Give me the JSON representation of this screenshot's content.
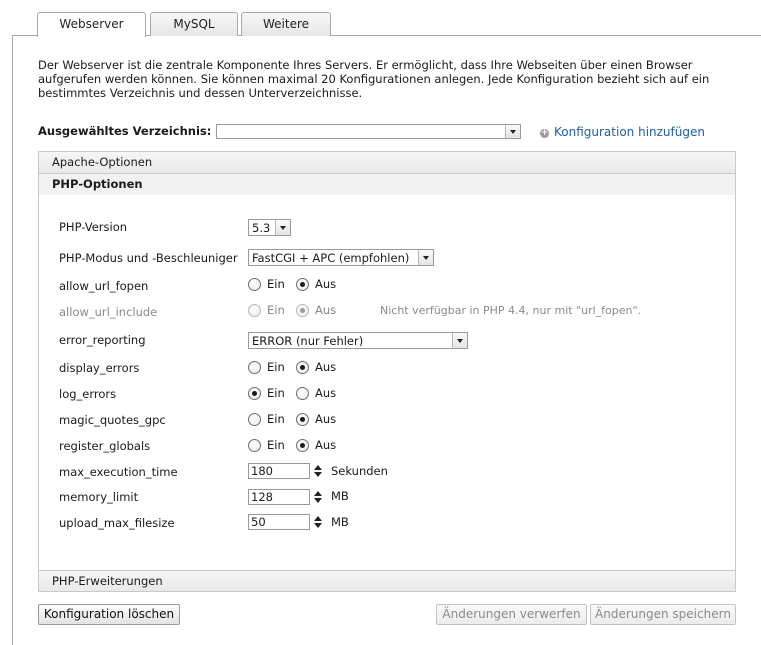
{
  "tabs": [
    {
      "label": "Webserver"
    },
    {
      "label": "MySQL"
    },
    {
      "label": "Weitere"
    }
  ],
  "intro_text": "Der Webserver ist die zentrale Komponente Ihres Servers. Er ermöglicht, dass Ihre Webseiten über einen Browser aufgerufen werden können. Sie können maximal 20 Konfigurationen anlegen. Jede Konfiguration bezieht sich auf ein bestimmtes Verzeichnis und dessen Unterverzeichnisse.",
  "directory": {
    "label": "Ausgewähltes Verzeichnis:",
    "value": "",
    "add_link": "Konfiguration hinzufügen"
  },
  "sections": {
    "apache": "Apache-Optionen",
    "php": "PHP-Optionen",
    "extensions": "PHP-Erweiterungen"
  },
  "php": {
    "version_label": "PHP-Version",
    "version_value": "5.3",
    "mode_label": "PHP-Modus und -Beschleuniger",
    "mode_value": "FastCGI + APC (empfohlen)",
    "allow_url_fopen": "allow_url_fopen",
    "allow_url_include": "allow_url_include",
    "allow_url_include_note": "Nicht verfügbar in PHP 4.4, nur mit \"url_fopen\".",
    "error_reporting": "error_reporting",
    "error_reporting_value": "ERROR (nur Fehler)",
    "display_errors": "display_errors",
    "log_errors": "log_errors",
    "magic_quotes_gpc": "magic_quotes_gpc",
    "register_globals": "register_globals",
    "max_execution_time": "max_execution_time",
    "max_execution_time_value": "180",
    "max_execution_time_unit": "Sekunden",
    "memory_limit": "memory_limit",
    "memory_limit_value": "128",
    "memory_limit_unit": "MB",
    "upload_max_filesize": "upload_max_filesize",
    "upload_max_filesize_value": "50",
    "upload_max_filesize_unit": "MB",
    "on_label": "Ein",
    "off_label": "Aus"
  },
  "buttons": {
    "delete": "Konfiguration löschen",
    "discard": "Änderungen verwerfen",
    "save": "Änderungen speichern"
  }
}
